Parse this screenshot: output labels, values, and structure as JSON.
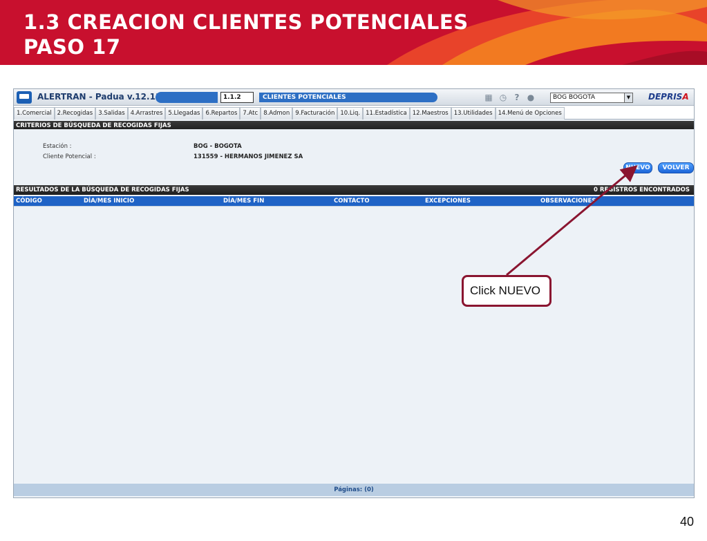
{
  "slide": {
    "title_line1": "1.3 CREACION CLIENTES POTENCIALES",
    "title_line2": "PASO 17",
    "page_number": "40",
    "callout": "Click NUEVO",
    "colors": {
      "banner": "#c8102e",
      "callout_border": "#8a1530"
    }
  },
  "app": {
    "name": "ALERTRAN - Padua  v.12.11.26",
    "screen_code": "1.1.2",
    "screen_name": "CLIENTES POTENCIALES",
    "station_select": "BOG BOGOTA",
    "brand": {
      "main": "DEPRIS",
      "accent": "A"
    },
    "toolbar_icons": [
      "calendar-icon",
      "clock-icon",
      "help-icon",
      "user-icon"
    ]
  },
  "menu": [
    "1.Comercial",
    "2.Recogidas",
    "3.Salidas",
    "4.Arrastres",
    "5.Llegadas",
    "6.Repartos",
    "7.Atc",
    "8.Admon",
    "9.Facturación",
    "10.Liq.",
    "11.Estadística",
    "12.Maestros",
    "13.Utilidades",
    "14.Menú de Opciones"
  ],
  "criteria": {
    "header": "CRITERIOS DE BÚSQUEDA DE RECOGIDAS FIJAS",
    "station_label": "Estación :",
    "station_value": "BOG - BOGOTA",
    "client_label": "Cliente Potencial :",
    "client_value": "131559 - HERMANOS JIMENEZ SA"
  },
  "buttons": {
    "nuevo": "NUEVO",
    "volver": "VOLVER"
  },
  "results": {
    "header": "RESULTADOS DE LA BÚSQUEDA DE RECOGIDAS FIJAS",
    "count_text": "0 REGISTROS ENCONTRADOS",
    "columns": [
      "CÓDIGO",
      "DÍA/MES INICIO",
      "DÍA/MES FIN",
      "CONTACTO",
      "EXCEPCIONES",
      "OBSERVACIONES"
    ],
    "pager": "Páginas: (0)"
  }
}
